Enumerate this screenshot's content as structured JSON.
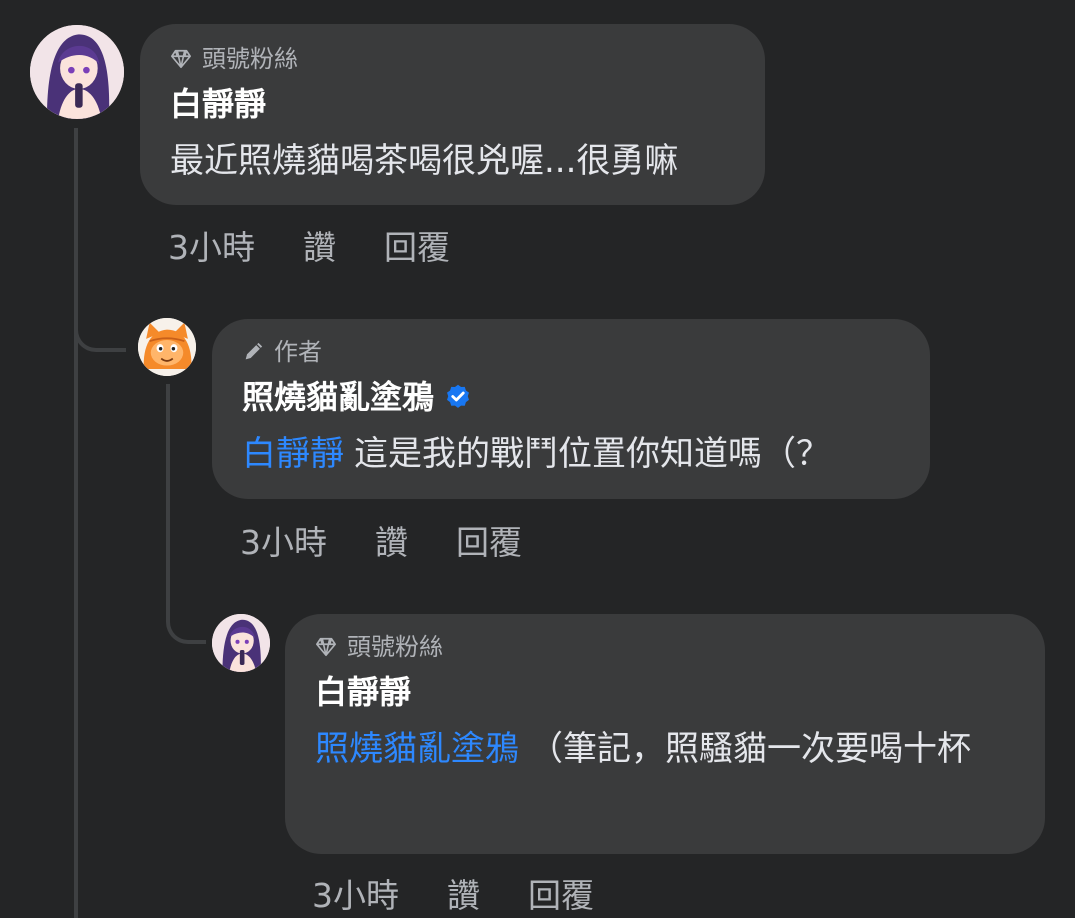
{
  "comments": [
    {
      "badge": "頭號粉絲",
      "badge_icon": "diamond-icon",
      "name": "白靜靜",
      "verified": false,
      "mention": "",
      "text": "最近照燒貓喝茶喝很兇喔...很勇嘛",
      "time": "3小時",
      "like_label": "讚",
      "reply_label": "回覆"
    },
    {
      "badge": "作者",
      "badge_icon": "pen-icon",
      "name": "照燒貓亂塗鴉",
      "verified": true,
      "mention": "白靜靜",
      "text": "這是我的戰鬥位置你知道嗎（？",
      "time": "3小時",
      "like_label": "讚",
      "reply_label": "回覆"
    },
    {
      "badge": "頭號粉絲",
      "badge_icon": "diamond-icon",
      "name": "白靜靜",
      "verified": false,
      "mention": "照燒貓亂塗鴉",
      "text": "（筆記，照騷貓一次要喝十杯",
      "time": "3小時",
      "like_label": "讚",
      "reply_label": "回覆"
    }
  ],
  "colors": {
    "background": "#242526",
    "bubble": "#3a3b3c",
    "mention": "#2d88ff",
    "verified": "#1877f2",
    "secondary_text": "#b0b3b8"
  }
}
